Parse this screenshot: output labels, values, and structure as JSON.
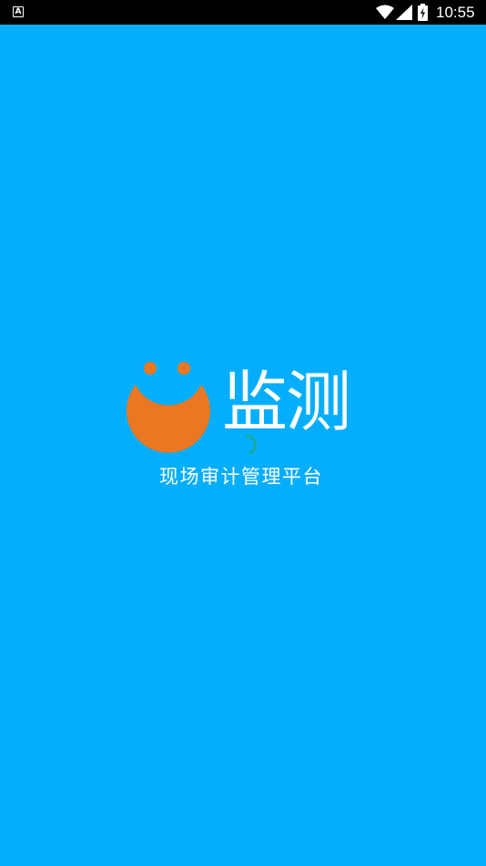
{
  "status_bar": {
    "notification_glyph": "A",
    "time": "10:55",
    "icons": [
      "notification-icon",
      "wifi-icon",
      "signal-icon",
      "battery-icon"
    ]
  },
  "splash": {
    "app_name": "监测",
    "tagline": "现场审计管理平台",
    "loading_indicator": "spinner-icon"
  },
  "colors": {
    "background": "#05AEFB",
    "logo_orange": "#EA7722",
    "text": "#FFFFFF",
    "spinner": "#19A98A",
    "status_bar": "#000000"
  }
}
